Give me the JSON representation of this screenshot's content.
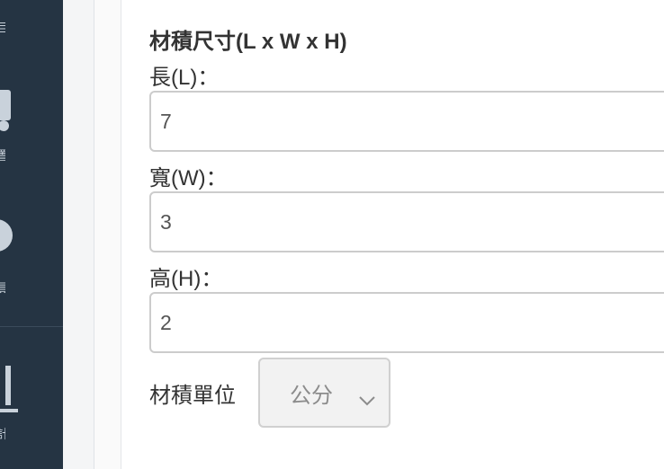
{
  "sidebar": {
    "items": [
      {
        "icon": "list-icon",
        "label": "目"
      },
      {
        "icon": "truck-icon",
        "label": "置"
      },
      {
        "icon": "user-icon",
        "label": "員"
      },
      {
        "icon": "bar-chart-icon",
        "label": "計"
      }
    ]
  },
  "form": {
    "section_title": "材積尺寸(L x W x H)",
    "length": {
      "label": "長(L)：",
      "value": "7"
    },
    "width": {
      "label": "寬(W)：",
      "value": "3"
    },
    "height": {
      "label": "高(H)：",
      "value": "2"
    },
    "unit": {
      "label": "材積單位",
      "selected": "公分"
    }
  },
  "colors": {
    "sidebar_bg": "#253443",
    "sidebar_fg": "#c9d2db",
    "border": "#cccccc",
    "select_bg": "#f2f2f2"
  }
}
